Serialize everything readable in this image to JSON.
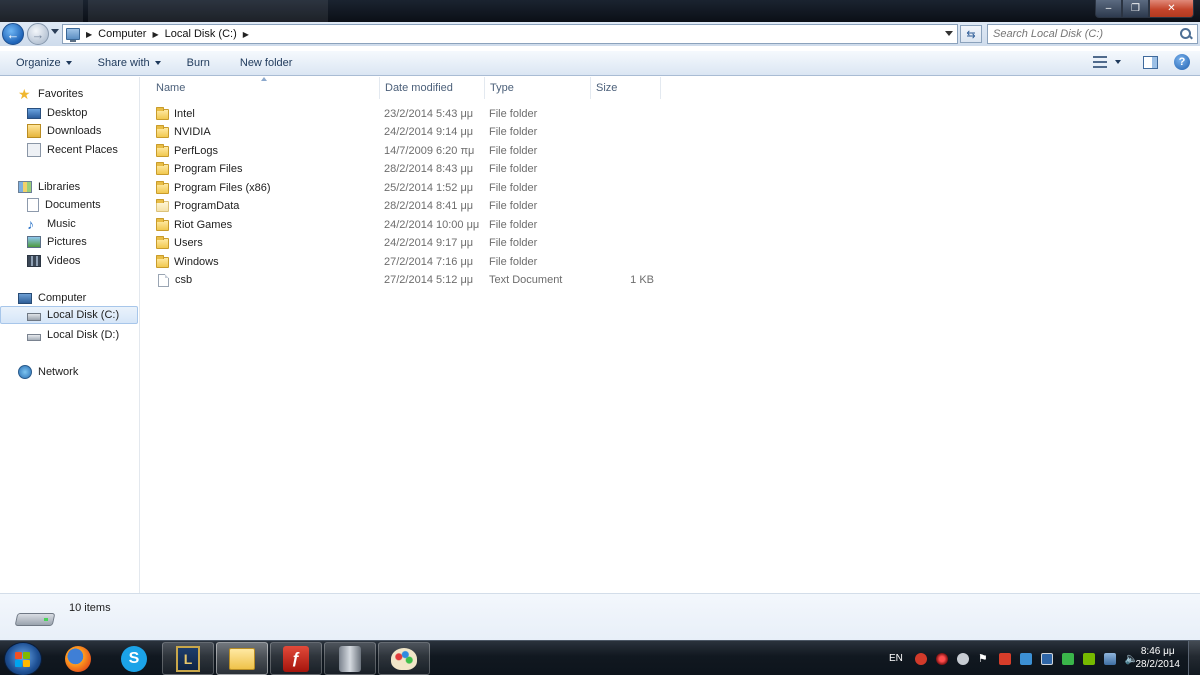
{
  "window": {
    "controls": {
      "minimize": "–",
      "maximize": "❐",
      "close": "✕"
    }
  },
  "address_bar": {
    "breadcrumbs": [
      "Computer",
      "Local Disk (C:)"
    ],
    "refresh_icon": "refresh-icon",
    "search_placeholder": "Search Local Disk (C:)"
  },
  "command_bar": {
    "items": [
      {
        "label": "Organize",
        "dropdown": true
      },
      {
        "label": "Share with",
        "dropdown": true
      },
      {
        "label": "Burn",
        "dropdown": false
      },
      {
        "label": "New folder",
        "dropdown": false
      }
    ]
  },
  "nav_pane": {
    "favorites": {
      "label": "Favorites",
      "items": [
        "Desktop",
        "Downloads",
        "Recent Places"
      ]
    },
    "libraries": {
      "label": "Libraries",
      "items": [
        "Documents",
        "Music",
        "Pictures",
        "Videos"
      ]
    },
    "computer": {
      "label": "Computer",
      "items": [
        "Local Disk (C:)",
        "Local Disk (D:)"
      ],
      "selected": "Local Disk (C:)"
    },
    "network": {
      "label": "Network"
    }
  },
  "file_list": {
    "columns": [
      "Name",
      "Date modified",
      "Type",
      "Size"
    ],
    "rows": [
      {
        "name": "Intel",
        "date": "23/2/2014 5:43 μμ",
        "type": "File folder",
        "size": "",
        "icon": "folder-icon"
      },
      {
        "name": "NVIDIA",
        "date": "24/2/2014 9:14 μμ",
        "type": "File folder",
        "size": "",
        "icon": "folder-icon"
      },
      {
        "name": "PerfLogs",
        "date": "14/7/2009 6:20 πμ",
        "type": "File folder",
        "size": "",
        "icon": "folder-icon"
      },
      {
        "name": "Program Files",
        "date": "28/2/2014 8:43 μμ",
        "type": "File folder",
        "size": "",
        "icon": "folder-icon"
      },
      {
        "name": "Program Files (x86)",
        "date": "25/2/2014 1:52 μμ",
        "type": "File folder",
        "size": "",
        "icon": "folder-icon"
      },
      {
        "name": "ProgramData",
        "date": "28/2/2014 8:41 μμ",
        "type": "File folder",
        "size": "",
        "icon": "folder-hidden-icon"
      },
      {
        "name": "Riot Games",
        "date": "24/2/2014 10:00 μμ",
        "type": "File folder",
        "size": "",
        "icon": "folder-icon"
      },
      {
        "name": "Users",
        "date": "24/2/2014 9:17 μμ",
        "type": "File folder",
        "size": "",
        "icon": "folder-icon"
      },
      {
        "name": "Windows",
        "date": "27/2/2014 7:16 μμ",
        "type": "File folder",
        "size": "",
        "icon": "folder-icon"
      },
      {
        "name": "csb",
        "date": "27/2/2014 5:12 μμ",
        "type": "Text Document",
        "size": "1 KB",
        "icon": "text-document-icon"
      }
    ]
  },
  "details_pane": {
    "item_count": "10 items"
  },
  "taskbar": {
    "apps": [
      "firefox-icon",
      "skype-icon",
      "league-of-legends-icon",
      "windows-explorer-icon",
      "flash-icon",
      "media-player-icon",
      "paint-icon"
    ],
    "tray": {
      "language": "EN"
    },
    "clock": {
      "time": "8:46 μμ",
      "date": "28/2/2014"
    }
  },
  "colors": {
    "accent": "#1f64b8",
    "taskbar": "#111820",
    "folder": "#f1c84f"
  }
}
